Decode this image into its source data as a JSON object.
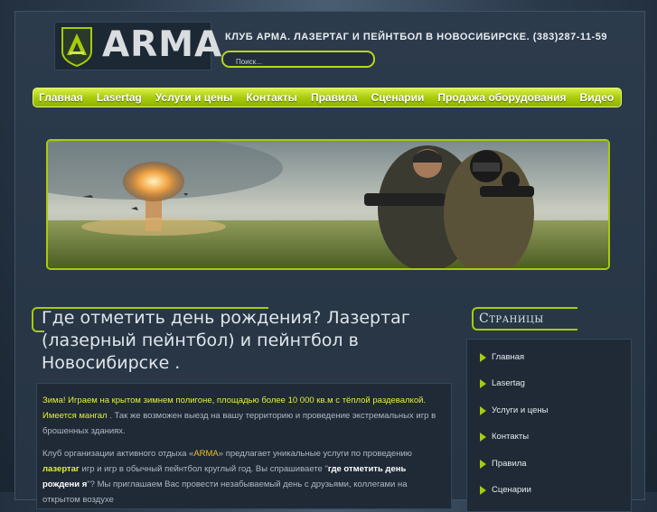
{
  "logo": {
    "text": "ARMA"
  },
  "header": {
    "title": "КЛУБ АРМА. ЛАЗЕРТАГ И ПЕЙНТБОЛ В НОВОСИБИРСКЕ. (383)287-11-59"
  },
  "search": {
    "placeholder": "Поиск..."
  },
  "nav": {
    "items": [
      "Главная",
      "Lasertag",
      "Услуги и цены",
      "Контакты",
      "Правила",
      "Сценарии",
      "Продажа оборудования",
      "Видео"
    ]
  },
  "main": {
    "title": "Где отметить день рождения? Лазертаг (лазерный пейнтбол) и пейнтбол в Новосибирске .",
    "p1_a": "Зима! Играем на крытом зимнем полигоне, площадью более 10 000 кв.м с тёплой раздевалкой. Имеется мангал",
    "p1_b": ". Так же возможен выезд на вашу территорию и проведение экстремальных игр в брошенных зданиях.",
    "p2_a": "Клуб организации активного отдыха «",
    "p2_brand": "ARMA",
    "p2_b": "» предлагает уникальные услуги по проведению",
    "p2_lasertag": "лазертаг",
    "p2_c": "игр и игр в обычный пейнтбол круглый год. Вы спрашиваете \"",
    "p2_q": "где отметить день рождени я",
    "p2_d": "\"? Мы приглашаем Вас провести незабываемый день с друзьями, коллегами на открытом воздухе"
  },
  "sidebar": {
    "title": "Страницы",
    "items": [
      "Главная",
      "Lasertag",
      "Услуги и цены",
      "Контакты",
      "Правила",
      "Сценарии"
    ]
  },
  "colors": {
    "accent": "#a6cc0a",
    "background": "#2b3a4b"
  }
}
